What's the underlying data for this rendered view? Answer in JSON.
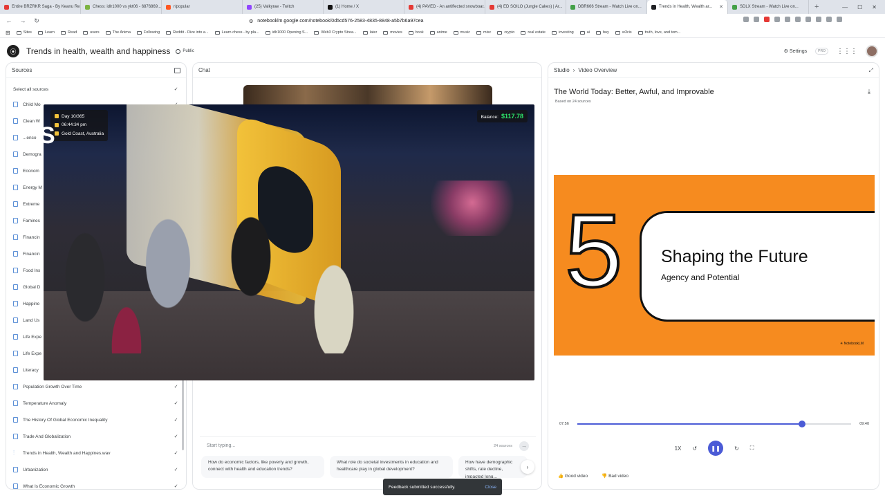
{
  "browser": {
    "tabs": [
      {
        "label": "Entire BRZRKR Saga - By Keanu Re...",
        "color": "#e53935"
      },
      {
        "label": "Chess: idlr1000 vs ykt06 - 6876869...",
        "color": "#7cb342"
      },
      {
        "label": "r/popular",
        "color": "#ff5722"
      },
      {
        "label": "(25) Valkyrae - Twitch",
        "color": "#9146ff"
      },
      {
        "label": "(1) Home / X",
        "color": "#111111"
      },
      {
        "label": "(4) PAVED - An antiflected snowboar...",
        "color": "#e53935"
      },
      {
        "label": "(4) ED SOILO (Jungle Cakes) | Ar...",
        "color": "#e53935"
      },
      {
        "label": "DBR666 Stream - Watch Live on...",
        "color": "#43a047"
      },
      {
        "label": "Trends in Health, Wealth ar...",
        "color": "#202124",
        "active": true
      },
      {
        "label": "SDLX Stream - Watch Live on...",
        "color": "#43a047"
      }
    ],
    "url": "notebooklm.google.com/notebook/0d5cd576-2583-4835-8848-a5b7b6a97cea",
    "bookmarks": [
      "Sites",
      "Learn",
      "Read",
      "users",
      "The Anima",
      "Following",
      "Reddit - Dive into a...",
      "Learn chess - by pla...",
      "idlr1000 Opening S...",
      "Web3 Crypto Strea...",
      "later",
      "movies",
      "book",
      "anime",
      "music",
      "misc",
      "crypto",
      "real estate",
      "investing",
      "ai",
      "buy",
      "w3cis",
      "truth, love, and tom..."
    ]
  },
  "header": {
    "logo": "⦿",
    "title": "Trends in health, wealth and happiness",
    "visibility": "Public",
    "settings_label": "Settings",
    "pro_badge": "PRO"
  },
  "sources": {
    "title": "Sources",
    "select_all": "Select all sources",
    "items": [
      {
        "label": "Child Mo",
        "icon": "doc"
      },
      {
        "label": "Clean W",
        "icon": "doc"
      },
      {
        "label": "...enco",
        "icon": "doc"
      },
      {
        "label": "Demogra",
        "icon": "doc"
      },
      {
        "label": "Econom",
        "icon": "doc"
      },
      {
        "label": "Energy M",
        "icon": "doc"
      },
      {
        "label": "Extreme",
        "icon": "doc"
      },
      {
        "label": "Famines",
        "icon": "doc"
      },
      {
        "label": "Financin",
        "icon": "doc"
      },
      {
        "label": "Financin",
        "icon": "doc"
      },
      {
        "label": "Food Ins",
        "icon": "doc"
      },
      {
        "label": "Global D",
        "icon": "doc"
      },
      {
        "label": "Happine",
        "icon": "doc"
      },
      {
        "label": "Land Us",
        "icon": "doc"
      },
      {
        "label": "Life Expe",
        "icon": "doc"
      },
      {
        "label": "Life Expe",
        "icon": "doc"
      },
      {
        "label": "Literacy",
        "icon": "doc"
      },
      {
        "label": "Population Growth Over Time",
        "icon": "doc"
      },
      {
        "label": "Temperature Anomaly",
        "icon": "doc"
      },
      {
        "label": "The History Of Global Economic Inequality",
        "icon": "doc"
      },
      {
        "label": "Trade And Globalization",
        "icon": "doc"
      },
      {
        "label": "Trends in Health, Wealth and Happines.wav",
        "icon": "wave"
      },
      {
        "label": "Urbanization",
        "icon": "doc"
      },
      {
        "label": "What Is Economic Growth",
        "icon": "doc"
      }
    ]
  },
  "chat": {
    "title": "Chat",
    "input_placeholder": "Start typing...",
    "source_count": "24 sources",
    "suggestions": [
      "How do economic factors, like poverty and growth, connect with health and education trends?",
      "What role do societal investments in education and healthcare play in global development?",
      "How have demographic shifts, rate decline, impacted long..."
    ]
  },
  "studio": {
    "crumb_root": "Studio",
    "crumb_current": "Video Overview",
    "video_title": "The World Today: Better, Awful, and Improvable",
    "video_subtitle": "Based on 24 sources",
    "slide": {
      "number": "5",
      "heading": "Shaping the Future",
      "subheading": "Agency and Potential",
      "brand": "NotebookLM",
      "color": "#f68b1f"
    },
    "time_current": "07:56",
    "time_total": "09:40",
    "progress_pct": 82,
    "speed": "1X",
    "good_video": "Good video",
    "bad_video": "Bad video"
  },
  "pip": {
    "day": "Day 10/365",
    "time": "06:44:34 pm",
    "location": "Gold Coast, Australia",
    "balance_label": "Balance:",
    "balance_value": "$117.78",
    "letter": "S"
  },
  "toast": {
    "message": "Feedback submitted successfully.",
    "close": "Close"
  }
}
